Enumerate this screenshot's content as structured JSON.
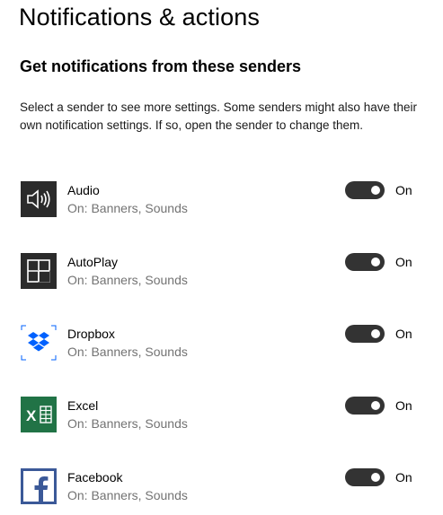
{
  "header": {
    "title": "Notifications & actions",
    "section_title": "Get notifications from these senders",
    "description": "Select a sender to see more settings. Some senders might also have their own notification settings. If so, open the sender to change them."
  },
  "senders": [
    {
      "name": "Audio",
      "status": "On: Banners, Sounds",
      "toggle_label": "On",
      "icon": "speaker-icon",
      "icon_bg": "#2b2b2b"
    },
    {
      "name": "AutoPlay",
      "status": "On: Banners, Sounds",
      "toggle_label": "On",
      "icon": "autoplay-icon",
      "icon_bg": "#2b2b2b"
    },
    {
      "name": "Dropbox",
      "status": "On: Banners, Sounds",
      "toggle_label": "On",
      "icon": "dropbox-icon",
      "icon_bg": "#ffffff",
      "icon_accent": "#0061fe"
    },
    {
      "name": "Excel",
      "status": "On: Banners, Sounds",
      "toggle_label": "On",
      "icon": "excel-icon",
      "icon_bg": "#217346"
    },
    {
      "name": "Facebook",
      "status": "On: Banners, Sounds",
      "toggle_label": "On",
      "icon": "facebook-icon",
      "icon_bg": "#3b5998"
    }
  ],
  "colors": {
    "toggle_on": "#333333",
    "secondary_text": "#737373"
  }
}
